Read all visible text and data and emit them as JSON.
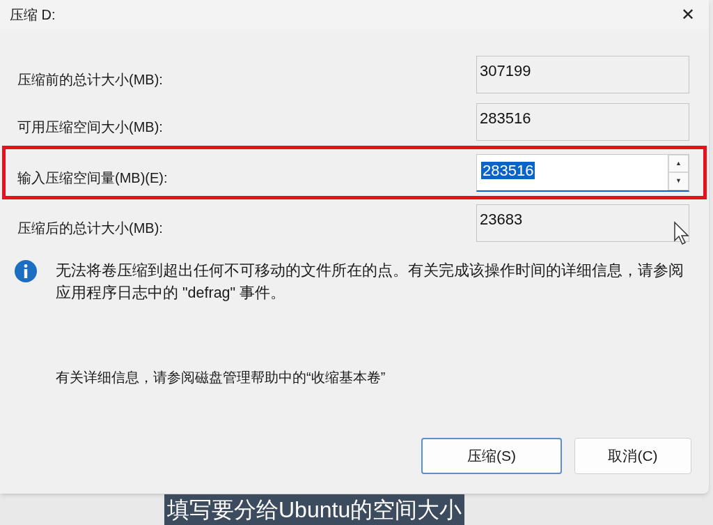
{
  "window": {
    "title": "压缩 D:",
    "close": "✕"
  },
  "fields": [
    {
      "kind": "readonly",
      "label": "压缩前的总计大小(MB):",
      "value": "307199",
      "highlighted": false,
      "value_selected": false
    },
    {
      "kind": "readonly",
      "label": "可用压缩空间大小(MB):",
      "value": "283516",
      "highlighted": false,
      "value_selected": false
    },
    {
      "kind": "spin",
      "label": "输入压缩空间量(MB)(E):",
      "value": "283516",
      "highlighted": true,
      "value_selected": true,
      "up": "▲",
      "down": "▼"
    },
    {
      "kind": "readonly",
      "label": "压缩后的总计大小(MB):",
      "value": "23683",
      "highlighted": false,
      "value_selected": false
    }
  ],
  "info": {
    "message": "无法将卷压缩到超出任何不可移动的文件所在的点。有关完成该操作时间的详细信息，请参阅应用程序日志中的 \"defrag\" 事件。",
    "help": "有关详细信息，请参阅磁盘管理帮助中的“收缩基本卷”"
  },
  "buttons": [
    {
      "label": "压缩(S)",
      "default": true
    },
    {
      "label": "取消(C)",
      "default": false
    }
  ],
  "subtitle": "填写要分给Ubuntu的空间大小"
}
